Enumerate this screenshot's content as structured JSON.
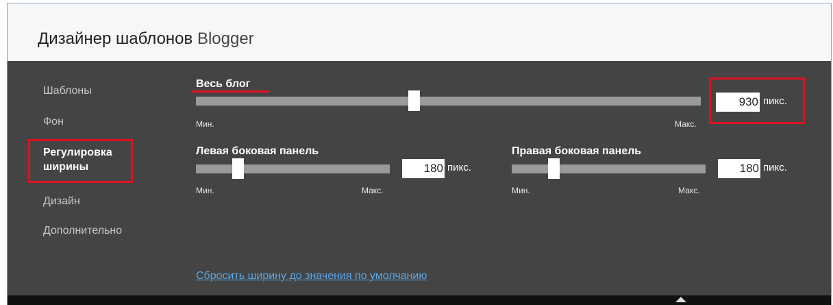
{
  "header": {
    "title_prefix": "Дизайнер шаблонов",
    "title_brand": "Blogger"
  },
  "sidebar": {
    "items": [
      {
        "label": "Шаблоны"
      },
      {
        "label": "Фон"
      },
      {
        "label_line1": "Регулировка",
        "label_line2": "ширины"
      },
      {
        "label": "Дизайн"
      },
      {
        "label": "Дополнительно"
      }
    ]
  },
  "blog_width": {
    "label": "Весь блог",
    "value": "930",
    "unit": "пикс.",
    "min_label": "Мин.",
    "max_label": "Макс.",
    "slider_fraction": 0.43
  },
  "left_sidebar": {
    "label": "Левая боковая панель",
    "value": "180",
    "unit": "пикс.",
    "min_label": "Мин.",
    "max_label": "Макс.",
    "slider_fraction": 0.2
  },
  "right_sidebar": {
    "label": "Правая боковая панель",
    "value": "180",
    "unit": "пикс.",
    "min_label": "Мин.",
    "max_label": "Макс.",
    "slider_fraction": 0.2
  },
  "reset_link": "Сбросить ширину до значения по умолчанию",
  "colors": {
    "annotation_red": "#e0111f",
    "panel_bg": "#444444",
    "link": "#5aa6e6"
  }
}
